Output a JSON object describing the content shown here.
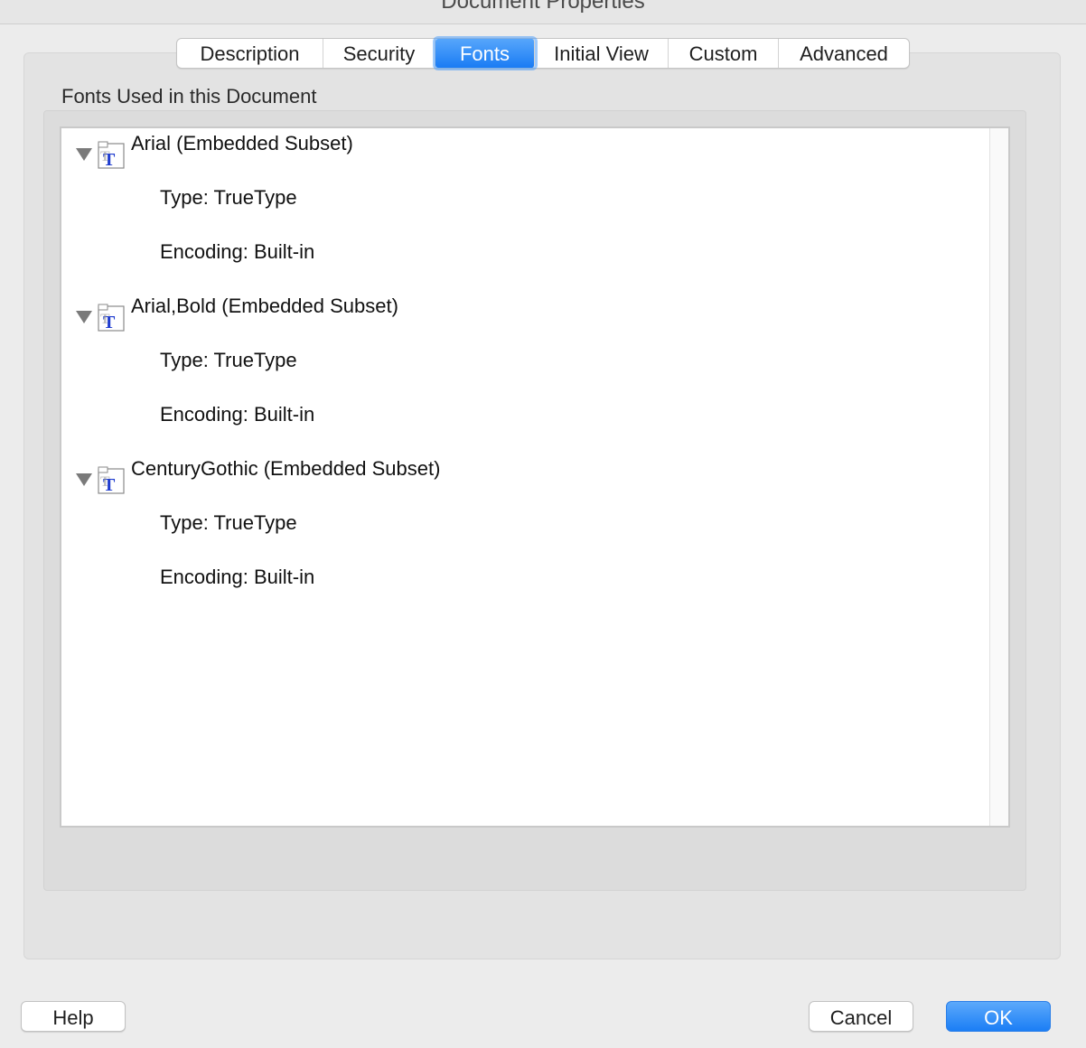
{
  "window": {
    "title": "Document Properties"
  },
  "tabs": [
    {
      "label": "Description",
      "active": false
    },
    {
      "label": "Security",
      "active": false
    },
    {
      "label": "Fonts",
      "active": true
    },
    {
      "label": "Initial View",
      "active": false
    },
    {
      "label": "Custom",
      "active": false
    },
    {
      "label": "Advanced",
      "active": false
    }
  ],
  "fonts_panel": {
    "section_label": "Fonts Used in this Document",
    "fonts": [
      {
        "name": "Arial (Embedded Subset)",
        "type": "Type: TrueType",
        "encoding": "Encoding: Built-in",
        "expanded": true,
        "icon": "truetype-font-icon"
      },
      {
        "name": "Arial,Bold (Embedded Subset)",
        "type": "Type: TrueType",
        "encoding": "Encoding: Built-in",
        "expanded": true,
        "icon": "truetype-font-icon"
      },
      {
        "name": "CenturyGothic (Embedded Subset)",
        "type": "Type: TrueType",
        "encoding": "Encoding: Built-in",
        "expanded": true,
        "icon": "truetype-font-icon"
      }
    ]
  },
  "buttons": {
    "help": "Help",
    "cancel": "Cancel",
    "ok": "OK"
  },
  "colors": {
    "accent": "#1a7cf4",
    "window_bg": "#ececec"
  }
}
